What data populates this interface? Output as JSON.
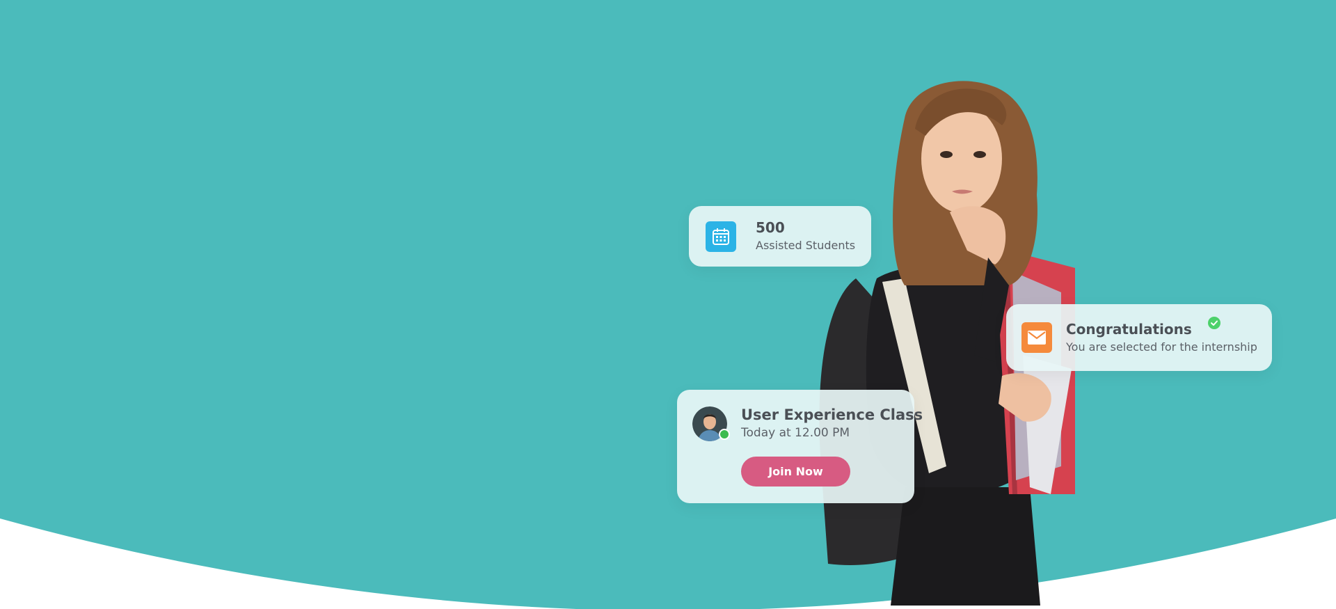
{
  "colors": {
    "background_teal": "#4bbbbb",
    "white": "#ffffff",
    "card_background": "#e8f6f6",
    "calendar_icon_blue": "#2bb3e6",
    "mail_icon_orange": "#f58a3c",
    "join_button_pink": "#d75b82",
    "online_green": "#3dbb4f",
    "check_green": "#4cd16a"
  },
  "students_card": {
    "icon": "calendar-icon",
    "count": "500",
    "label": "Assisted Students"
  },
  "congrats_card": {
    "icon": "mail-icon",
    "title": "Congratulations",
    "message": "You are selected for the internship",
    "status_icon": "check-circle-icon"
  },
  "class_card": {
    "avatar": "avatar",
    "title": "User Experience Class",
    "time": "Today at 12.00 PM",
    "button_label": "Join Now"
  }
}
